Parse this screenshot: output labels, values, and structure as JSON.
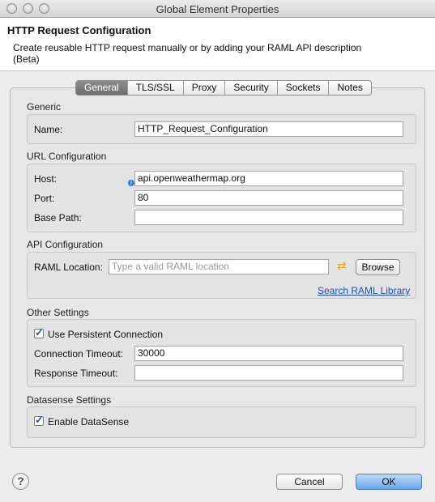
{
  "window": {
    "title": "Global Element Properties"
  },
  "header": {
    "title": "HTTP Request Configuration",
    "description": "Create reusable HTTP request manually or by adding your RAML API description (Beta)"
  },
  "tabs": [
    {
      "label": "General",
      "active": true
    },
    {
      "label": "TLS/SSL"
    },
    {
      "label": "Proxy"
    },
    {
      "label": "Security"
    },
    {
      "label": "Sockets"
    },
    {
      "label": "Notes"
    }
  ],
  "generic": {
    "section": "Generic",
    "name_label": "Name:",
    "name_value": "HTTP_Request_Configuration"
  },
  "url": {
    "section": "URL Configuration",
    "host_label": "Host:",
    "host_value": "api.openweathermap.org",
    "port_label": "Port:",
    "port_value": "80",
    "basepath_label": "Base Path:",
    "basepath_value": ""
  },
  "api": {
    "section": "API Configuration",
    "raml_label": "RAML Location:",
    "raml_placeholder": "Type a valid RAML location",
    "browse_label": "Browse",
    "search_link": "Search RAML Library"
  },
  "other": {
    "section": "Other Settings",
    "persistent_label": "Use Persistent Connection",
    "persistent_checked": true,
    "conn_timeout_label": "Connection Timeout:",
    "conn_timeout_value": "30000",
    "resp_timeout_label": "Response Timeout:",
    "resp_timeout_value": ""
  },
  "datasense": {
    "section": "Datasense Settings",
    "enable_label": "Enable DataSense",
    "enable_checked": true
  },
  "footer": {
    "help_glyph": "?",
    "cancel_label": "Cancel",
    "ok_label": "OK"
  },
  "colors": {
    "accent": "#6ea6e8",
    "link": "#1b4fbf"
  }
}
